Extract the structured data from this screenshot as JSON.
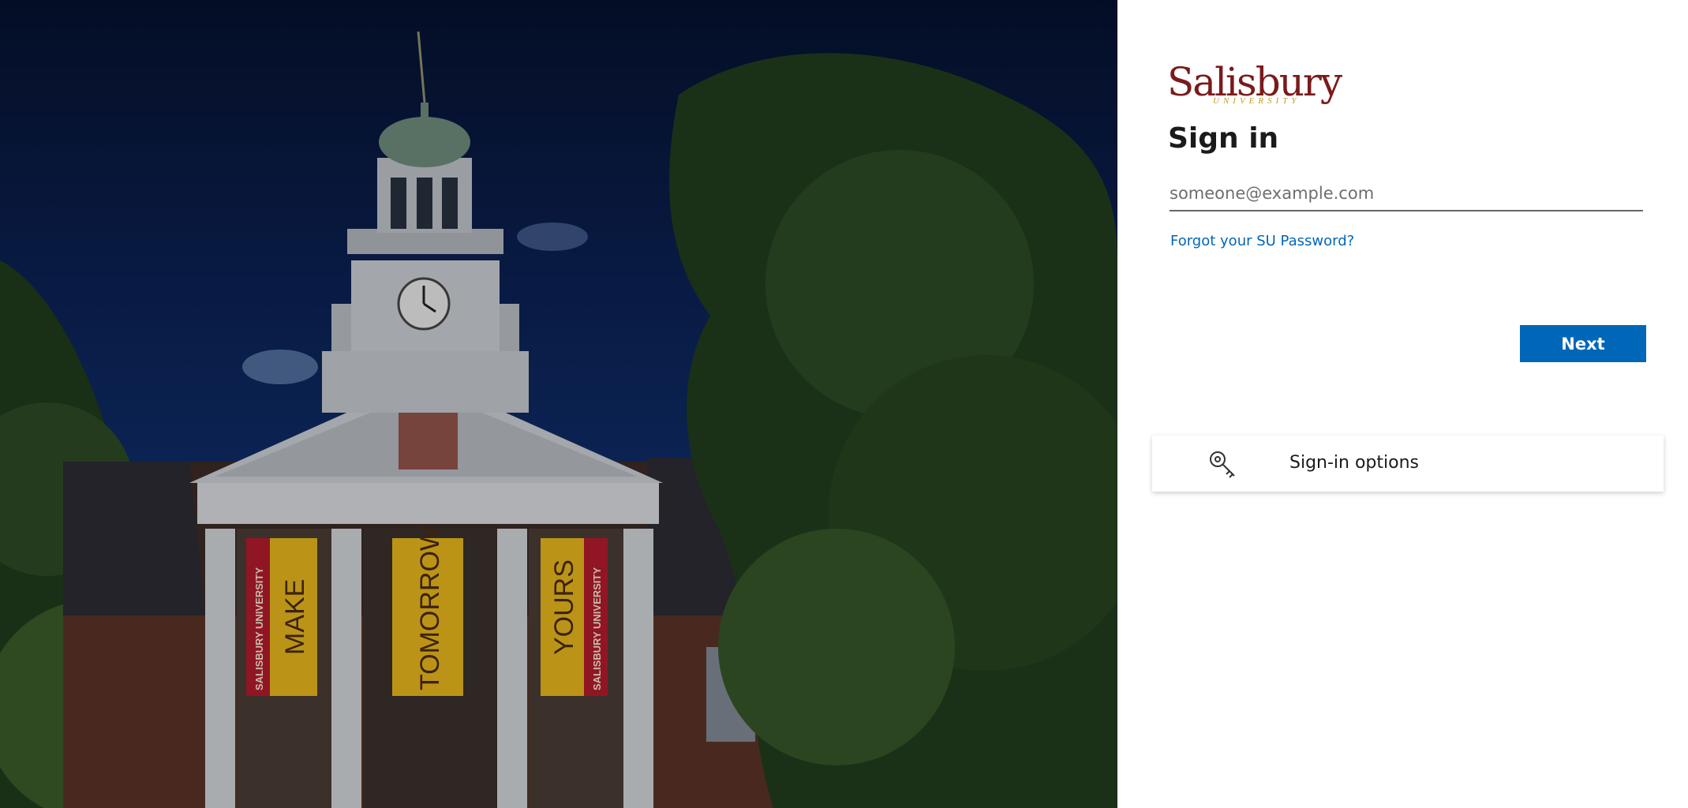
{
  "background": {
    "banners": [
      "SALISBURY UNIVERSITY",
      "MAKE",
      "TOMORROW",
      "YOURS",
      "SALISBURY UNIVERSITY"
    ]
  },
  "logo": {
    "word": "Salisbury",
    "sub": "UNIVERSITY"
  },
  "signin": {
    "title": "Sign in",
    "email_placeholder": "someone@example.com",
    "email_value": "",
    "forgot_link": "Forgot your SU Password?",
    "next_label": "Next",
    "options_label": "Sign-in options",
    "options_icon": "key-icon"
  },
  "colors": {
    "primary": "#0067b8",
    "logo_red": "#7a1b1b",
    "logo_gold": "#c49a1a"
  }
}
